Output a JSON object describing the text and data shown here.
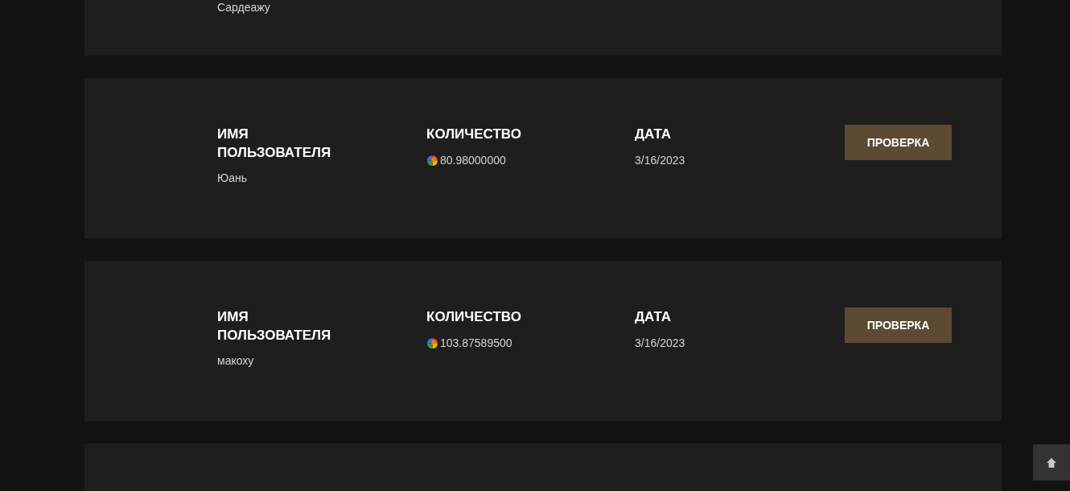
{
  "records": [
    {
      "kind": "partial",
      "username": "Сардеажу"
    },
    {
      "kind": "full",
      "username_label": "ИМЯ ПОЛЬЗОВАТЕЛЯ",
      "username": "Юань",
      "amount_label": "КОЛИЧЕСТВО",
      "amount": "80.98000000",
      "date_label": "ДАТА",
      "date": "3/16/2023",
      "button": "ПРОВЕРКА"
    },
    {
      "kind": "full",
      "username_label": "ИМЯ ПОЛЬЗОВАТЕЛЯ",
      "username": "макоху",
      "amount_label": "КОЛИЧЕСТВО",
      "amount": "103.87589500",
      "date_label": "ДАТА",
      "date": "3/16/2023",
      "button": "ПРОВЕРКА"
    },
    {
      "kind": "empty"
    }
  ]
}
